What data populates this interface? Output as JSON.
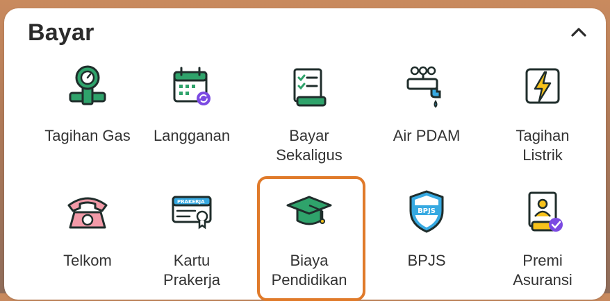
{
  "section": {
    "title": "Bayar",
    "collapse_icon": "chevron-up-icon"
  },
  "items": [
    {
      "label": "Tagihan Gas",
      "icon": "gas-meter-icon"
    },
    {
      "label": "Langganan",
      "icon": "calendar-subscription-icon"
    },
    {
      "label": "Bayar\nSekaligus",
      "icon": "checklist-receipt-icon"
    },
    {
      "label": "Air PDAM",
      "icon": "water-tap-icon"
    },
    {
      "label": "Tagihan\nListrik",
      "icon": "lightning-icon"
    },
    {
      "label": "Telkom",
      "icon": "telephone-icon"
    },
    {
      "label": "Kartu\nPrakerja",
      "icon": "prakerja-card-icon",
      "card_text": "PRAKERJA"
    },
    {
      "label": "Biaya\nPendidikan",
      "icon": "graduation-cap-icon",
      "selected": true
    },
    {
      "label": "BPJS",
      "icon": "bpjs-shield-icon",
      "badge_text": "BPJS"
    },
    {
      "label": "Premi\nAsuransi",
      "icon": "insurance-document-icon"
    }
  ],
  "colors": {
    "green": "#2fa36b",
    "dark_outline": "#1f2d2b",
    "highlight": "#e07a2a",
    "purple": "#7b4ae2",
    "blue": "#36a9e1",
    "yellow": "#f7c21a",
    "pink": "#f29aa8"
  }
}
